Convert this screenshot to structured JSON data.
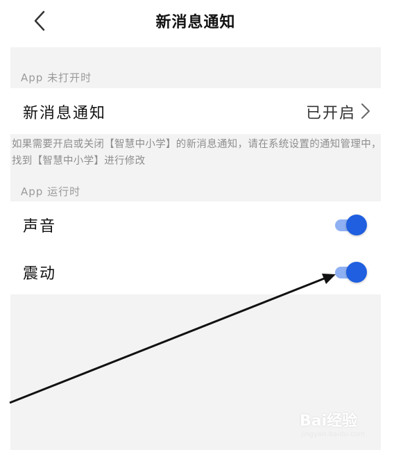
{
  "header": {
    "title": "新消息通知"
  },
  "section_closed": {
    "label": "App 未打开时",
    "row": {
      "label": "新消息通知",
      "value": "已开启"
    },
    "hint": "如果需要开启或关闭【智慧中小学】的新消息通知，请在系统设置的通知管理中，找到【智慧中小学】进行修改"
  },
  "section_running": {
    "label": "App 运行时",
    "rows": [
      {
        "label": "声音",
        "enabled": true
      },
      {
        "label": "震动",
        "enabled": true
      }
    ]
  },
  "colors": {
    "toggle_on": "#1f5fe0",
    "toggle_track": "#8fb0f2",
    "background": "#f3f3f3",
    "hint_text": "#8e8e8e"
  },
  "watermark": {
    "main": "Bai经验",
    "sub": "jingyan.baidu.com"
  }
}
